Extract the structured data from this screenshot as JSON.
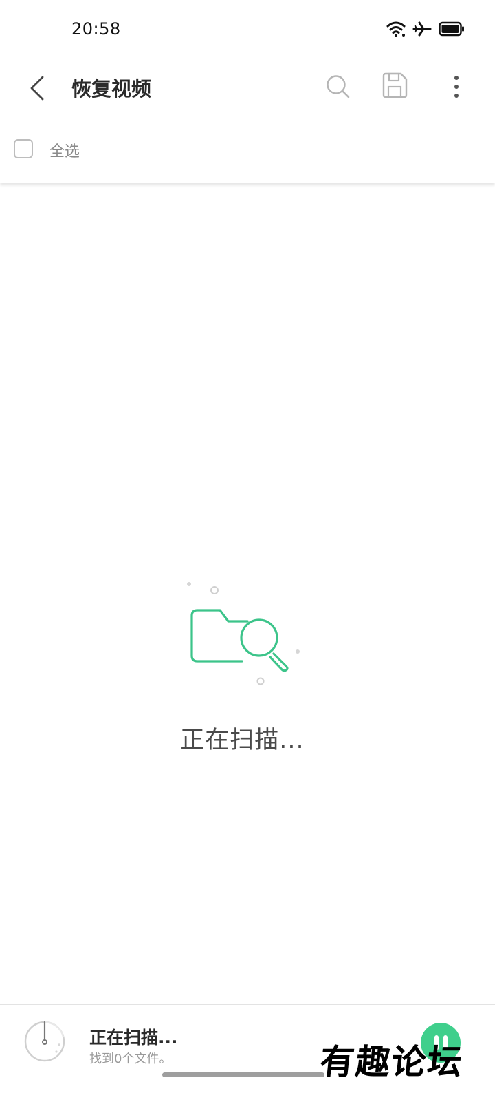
{
  "status_bar": {
    "time": "20:58",
    "icons": [
      "wifi-icon",
      "airplane-mode-icon",
      "battery-icon"
    ]
  },
  "app_bar": {
    "title": "恢复视频",
    "actions": [
      "back-arrow-icon",
      "search-icon",
      "save-icon",
      "more-vertical-icon"
    ]
  },
  "select_all": {
    "label": "全选",
    "checked": false
  },
  "empty_state": {
    "icon": "folder-search-icon",
    "message": "正在扫描..."
  },
  "bottom_bar": {
    "title": "正在扫描...",
    "subtitle": "找到0个文件。",
    "pause_icon": "pause-icon"
  },
  "watermark": {
    "text": "有趣论坛"
  },
  "colors": {
    "accent": "#3fcf8c",
    "illustration": "#3cc48a",
    "text_primary": "#2b2b2b",
    "text_secondary": "#8a8a8a"
  }
}
